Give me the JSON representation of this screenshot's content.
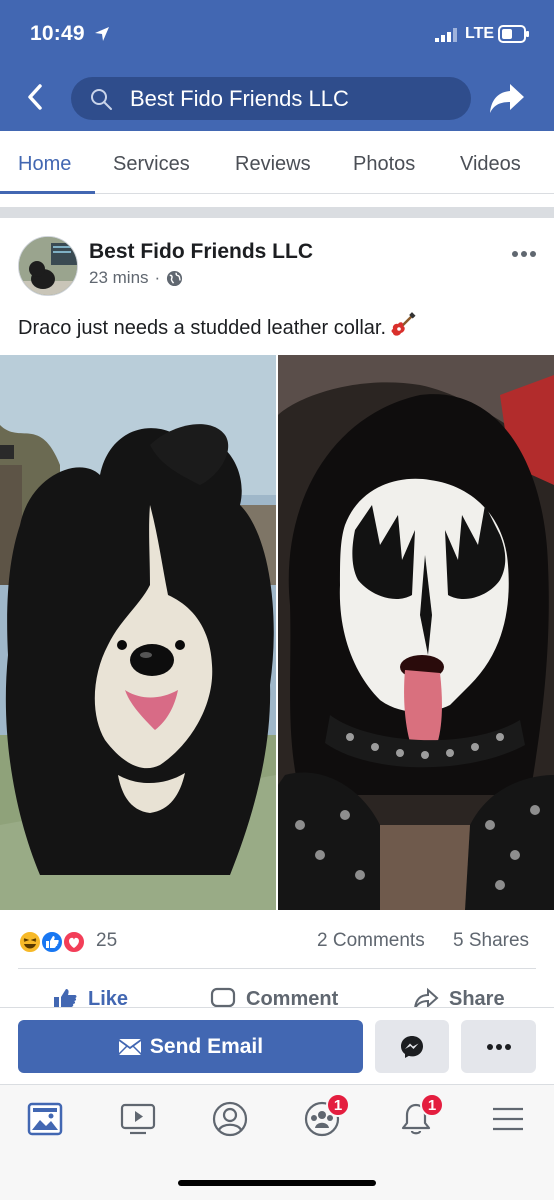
{
  "status_bar": {
    "time": "10:49",
    "network": "LTE"
  },
  "header": {
    "search_text": "Best Fido Friends LLC"
  },
  "tabs": [
    {
      "label": "Home",
      "active": true
    },
    {
      "label": "Services",
      "active": false
    },
    {
      "label": "Reviews",
      "active": false
    },
    {
      "label": "Photos",
      "active": false
    },
    {
      "label": "Videos",
      "active": false
    }
  ],
  "post": {
    "author": "Best Fido Friends LLC",
    "time": "23 mins",
    "separator": "·",
    "text": "Draco just needs a studded leather collar.",
    "image_alt": "Side-by-side photo: a black and white shaggy dog and a rock musician in black and white face paint"
  },
  "reactions": {
    "count": "25",
    "comments": "2 Comments",
    "shares": "5 Shares",
    "types": [
      "haha-icon",
      "like-icon",
      "love-icon"
    ]
  },
  "actions": {
    "like": "Like",
    "comment": "Comment",
    "share": "Share"
  },
  "page_actions": {
    "send_email": "Send Email"
  },
  "bottom_tabs": {
    "groups_badge": "1",
    "notifications_badge": "1"
  },
  "colors": {
    "brand_blue": "#4267b2",
    "badge_red": "#e41e3f",
    "text_secondary": "#606770"
  }
}
